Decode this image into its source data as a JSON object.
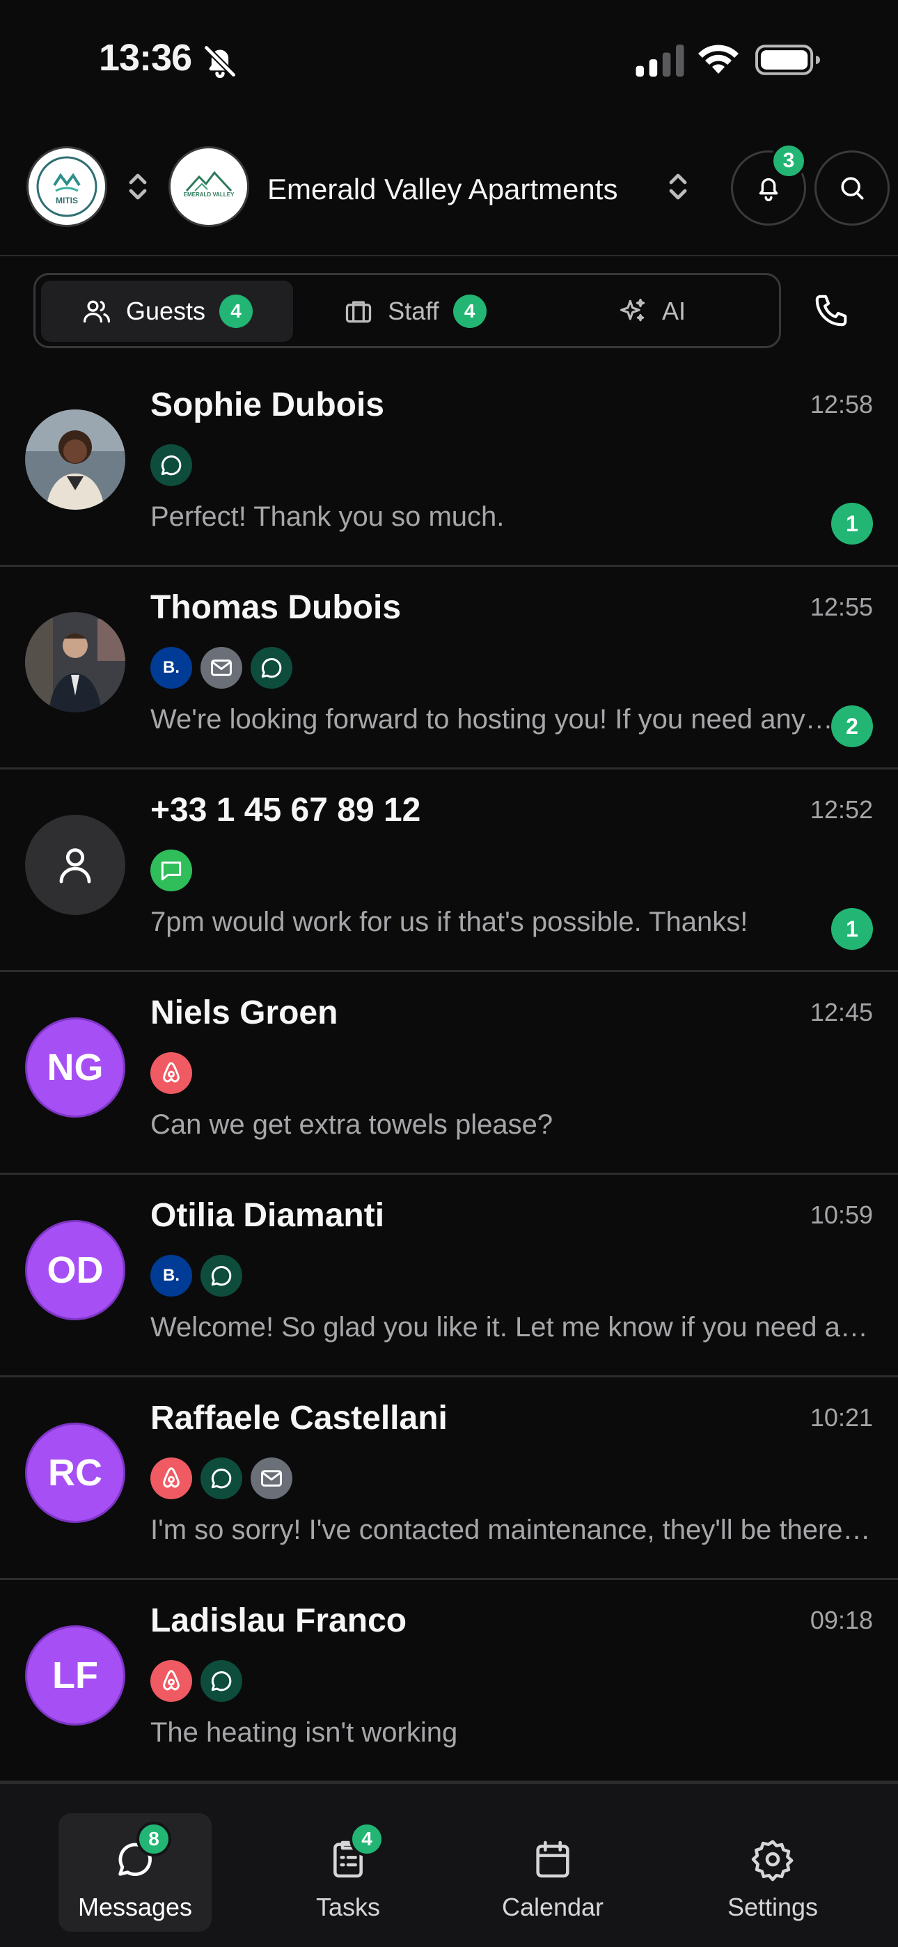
{
  "status_bar": {
    "time": "13:36",
    "icons": [
      "bell-off-icon",
      "signal-icon",
      "wifi-icon",
      "battery-icon"
    ]
  },
  "header": {
    "org_logo": "MITIS",
    "property_logo": "EMERALD VALLEY",
    "property_name": "Emerald Valley Apartments",
    "notification_count": "3",
    "icons": [
      "bell-icon",
      "search-icon",
      "chevron-updown-icon"
    ]
  },
  "tabs": [
    {
      "label": "Guests",
      "count": "4",
      "icon": "users-icon",
      "active": true
    },
    {
      "label": "Staff",
      "count": "4",
      "icon": "briefcase-icon",
      "active": false
    },
    {
      "label": "AI",
      "count": "",
      "icon": "sparkles-icon",
      "active": false
    }
  ],
  "phone_icon": "phone-icon",
  "conversations": [
    {
      "name": "Sophie Dubois",
      "time": "12:58",
      "channels": [
        "whatsapp"
      ],
      "preview": "Perfect! Thank you so much.",
      "unread": "1",
      "avatar": "photo"
    },
    {
      "name": "Thomas Dubois",
      "time": "12:55",
      "channels": [
        "booking",
        "email",
        "whatsapp"
      ],
      "preview": "We're looking forward to hosting you! If you need anything before your arrival, just let us know.",
      "unread": "2",
      "avatar": "photo"
    },
    {
      "name": "+33 1 45 67 89 12",
      "time": "12:52",
      "channels": [
        "sms"
      ],
      "preview": "7pm would work for us if that's possible. Thanks!",
      "unread": "1",
      "avatar": "unknown"
    },
    {
      "name": "Niels Groen",
      "time": "12:45",
      "channels": [
        "airbnb"
      ],
      "preview": "Can we get extra towels please?",
      "unread": "",
      "avatar": "NG"
    },
    {
      "name": "Otilia Diamanti",
      "time": "10:59",
      "channels": [
        "booking",
        "whatsapp"
      ],
      "preview": "Welcome! So glad you like it. Let me know if you need anything else.",
      "unread": "",
      "avatar": "OD"
    },
    {
      "name": "Raffaele Castellani",
      "time": "10:21",
      "channels": [
        "airbnb",
        "whatsapp",
        "email"
      ],
      "preview": "I'm so sorry! I've contacted maintenance, they'll be there within the hour.",
      "unread": "",
      "avatar": "RC"
    },
    {
      "name": "Ladislau Franco",
      "time": "09:18",
      "channels": [
        "airbnb",
        "whatsapp"
      ],
      "preview": "The heating isn't working",
      "unread": "",
      "avatar": "LF"
    }
  ],
  "bottom_nav": [
    {
      "label": "Messages",
      "badge": "8",
      "icon": "message-icon",
      "active": true
    },
    {
      "label": "Tasks",
      "badge": "4",
      "icon": "clipboard-icon",
      "active": false
    },
    {
      "label": "Calendar",
      "badge": "",
      "icon": "calendar-icon",
      "active": false
    },
    {
      "label": "Settings",
      "badge": "",
      "icon": "gear-icon",
      "active": false
    }
  ],
  "colors": {
    "background": "#0b0b0c",
    "accent_green": "#22b573",
    "initials_purple": "#a64ff5",
    "airbnb": "#ef5a63",
    "booking": "#003b95",
    "whatsapp_bg": "#0e4d3c",
    "sms": "#2fbe5a"
  }
}
